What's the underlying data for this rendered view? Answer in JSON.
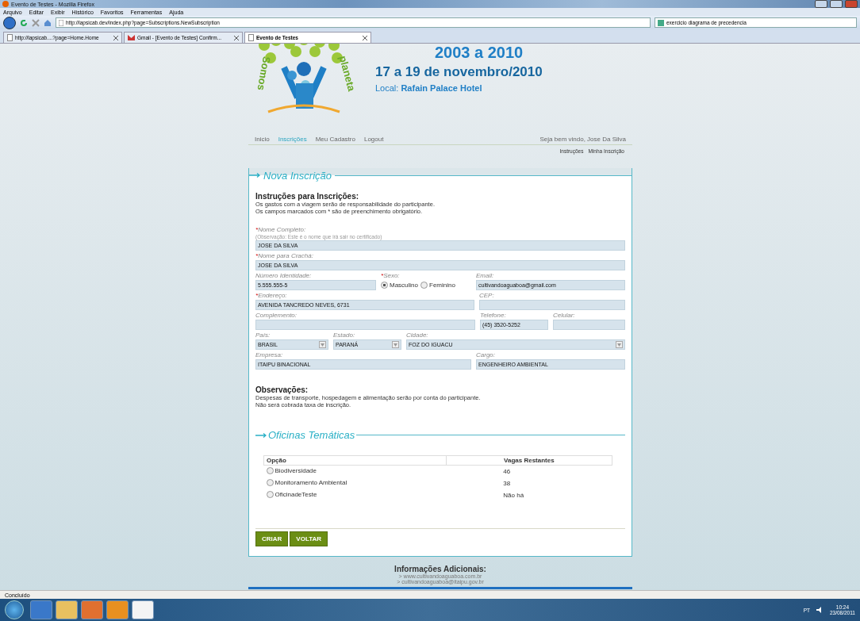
{
  "window": {
    "title": "Evento de Testes - Mozilla Firefox"
  },
  "menu": [
    "Arquivo",
    "Editar",
    "Exibir",
    "Histórico",
    "Favoritos",
    "Ferramentas",
    "Ajuda"
  ],
  "address": "http://lapsicab.dev/index.php?page=Subscriptions.NewSubscription",
  "search": "exercicio diagrama de precedencia",
  "tabs": [
    {
      "label": "http://lapsicab....?page=Home.Home",
      "selected": false,
      "kind": "page"
    },
    {
      "label": "Gmail - [Evento de Testes] Confirm...",
      "selected": false,
      "kind": "gmail"
    },
    {
      "label": "Evento de Testes",
      "selected": true,
      "kind": "page"
    }
  ],
  "header": {
    "logo_words": [
      "Somos",
      "planeta"
    ],
    "years": "2003 a 2010",
    "dates": "17 a 19 de novembro/2010",
    "local_label": "Local:",
    "local_value": "Rafain Palace Hotel"
  },
  "nav": [
    {
      "label": "Inicio",
      "selected": false
    },
    {
      "label": "Inscrições",
      "selected": true
    },
    {
      "label": "Meu Cadastro",
      "selected": false
    },
    {
      "label": "Logout",
      "selected": false
    }
  ],
  "welcome": "Seja bem vindo, Jose Da Silva",
  "sublinks": [
    "Instruções",
    "Minha Inscrição"
  ],
  "form": {
    "legend": "Nova Inscrição",
    "required_mark": "*",
    "instructions_title": "Instruções para Inscrições:",
    "instructions": [
      "Os gastos com a viagem serão de responsabilidade do participante.",
      "Os campos marcados com * são de preenchimento obrigatório."
    ],
    "rows": [
      [
        {
          "kind": "text",
          "label": "Nome Completo:",
          "required": true,
          "note": "(Observação: Este é o nome que irá sair no certificado)",
          "value": "JOSE DA SILVA"
        }
      ],
      [
        {
          "kind": "text",
          "label": "Nome para Crachá:",
          "required": true,
          "value": "JOSE DA SILVA"
        }
      ],
      [
        {
          "kind": "text",
          "label": "Número Identidade:",
          "required": false,
          "value": "5.555.555-5"
        },
        {
          "kind": "radio",
          "label": "Sexo:",
          "required": true,
          "options": [
            {
              "label": "Masculino",
              "selected": true
            },
            {
              "label": "Feminino",
              "selected": false
            }
          ]
        },
        {
          "kind": "text",
          "label": "Email:",
          "required": false,
          "value": "cultivandoaguaboa@gmail.com"
        }
      ],
      [
        {
          "kind": "text",
          "label": "Endereço:",
          "required": true,
          "value": "AVENIDA TANCREDO NEVES, 6731"
        },
        {
          "kind": "text",
          "label": "CEP:",
          "required": false
        }
      ],
      [
        {
          "kind": "text",
          "label": "Complemento:",
          "required": false
        },
        {
          "kind": "text",
          "label": "Telefone:",
          "required": false,
          "value": "(45) 3520-5252"
        },
        {
          "kind": "text",
          "label": "Celular:",
          "required": false
        }
      ],
      [
        {
          "kind": "select",
          "label": "País:",
          "required": false,
          "value": "BRASIL"
        },
        {
          "kind": "select",
          "label": "Estado:",
          "required": false,
          "value": "PARANÁ"
        },
        {
          "kind": "select",
          "label": "Cidade:",
          "required": false,
          "value": "FOZ DO IGUACU"
        }
      ],
      [
        {
          "kind": "text",
          "label": "Empresa:",
          "required": false,
          "value": "ITAIPU BINACIONAL"
        },
        {
          "kind": "text",
          "label": "Cargo:",
          "required": false,
          "value": "ENGENHEIRO AMBIENTAL"
        }
      ]
    ],
    "notes_title": "Observações:",
    "notes": [
      "Despesas de transporte, hospedagem e alimentação serão por conta do participante.",
      "Não será cobrada taxa de inscrição."
    ],
    "workshops_legend": "Oficinas Temáticas",
    "workshops": {
      "columns": [
        "Opção",
        "Vagas Restantes"
      ],
      "rows": [
        {
          "name": "Biodiversidade",
          "vagas": "46",
          "selected": false
        },
        {
          "name": "Monitoramento Ambiental",
          "vagas": "38",
          "selected": false
        },
        {
          "name": "OficinadeTeste",
          "vagas": "Não há",
          "selected": false
        }
      ]
    },
    "buttons": [
      "CRIAR",
      "VOLTAR"
    ]
  },
  "footer": {
    "title": "Informações Adicionais:",
    "links": [
      "> www.cultivandoaguaboa.com.br",
      "> cultivandoaguaboa@itaipu.gov.br"
    ]
  },
  "status_bar": "Concluído",
  "tray": {
    "lang": "PT",
    "time": "10:24",
    "date": "23/08/2011"
  }
}
